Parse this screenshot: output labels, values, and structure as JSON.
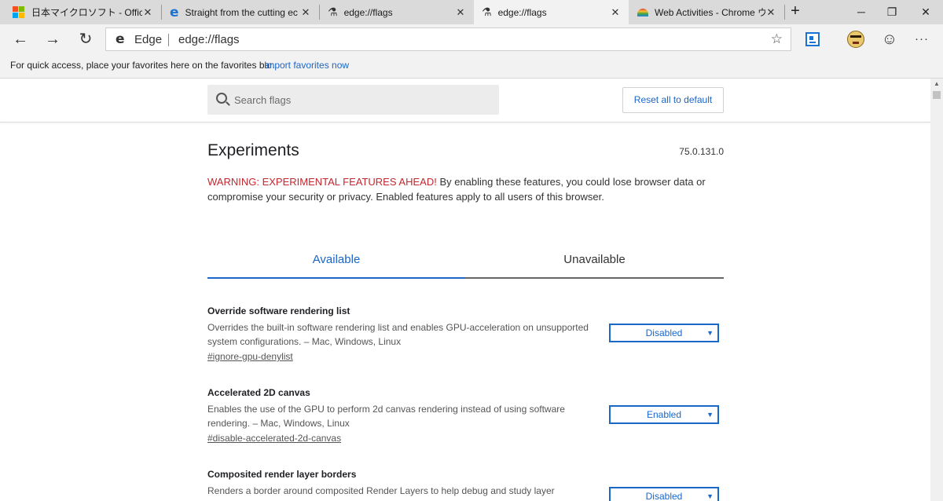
{
  "tabs": [
    {
      "title": "日本マイクロソフト - Official H",
      "close": "✕"
    },
    {
      "title": "Straight from the cutting ec",
      "close": "✕"
    },
    {
      "title": "edge://flags",
      "close": "✕"
    },
    {
      "title": "edge://flags",
      "close": "✕"
    },
    {
      "title": "Web Activities - Chrome ウ",
      "close": "✕"
    }
  ],
  "newtab": "+",
  "window": {
    "minimize": "─",
    "restore": "❐",
    "close": "✕"
  },
  "toolbar": {
    "back": "←",
    "forward": "→",
    "refresh": "↻",
    "site_label": "Edge",
    "url": "edge://flags",
    "favorite_star": "☆",
    "feedback": "☺",
    "more": "···"
  },
  "favbar": {
    "text": "For quick access, place your favorites here on the favorites bar.",
    "link": "Import favorites now"
  },
  "search": {
    "placeholder": "Search flags",
    "value": ""
  },
  "reset_button": "Reset all to default",
  "experiments": {
    "title": "Experiments",
    "version": "75.0.131.0",
    "warning_lead": "WARNING: EXPERIMENTAL FEATURES AHEAD!",
    "warning_rest": " By enabling these features, you could lose browser data or compromise your security or privacy. Enabled features apply to all users of this browser."
  },
  "flag_tabs": {
    "available": "Available",
    "unavailable": "Unavailable"
  },
  "flags": [
    {
      "name": "Override software rendering list",
      "description": "Overrides the built-in software rendering list and enables GPU-acceleration on unsupported system configurations. – Mac, Windows, Linux",
      "link": "#ignore-gpu-denylist",
      "value": "Disabled"
    },
    {
      "name": "Accelerated 2D canvas",
      "description": "Enables the use of the GPU to perform 2d canvas rendering instead of using software rendering. – Mac, Windows, Linux",
      "link": "#disable-accelerated-2d-canvas",
      "value": "Enabled"
    },
    {
      "name": "Composited render layer borders",
      "description": "Renders a border around composited Render Layers to help debug and study layer",
      "link": "",
      "value": "Disabled"
    }
  ],
  "caret": "▼",
  "colors": {
    "accent": "#1a66c9",
    "warning": "#c6262e",
    "tabbar": "#dadada",
    "toolbar": "#f2f2f2"
  }
}
